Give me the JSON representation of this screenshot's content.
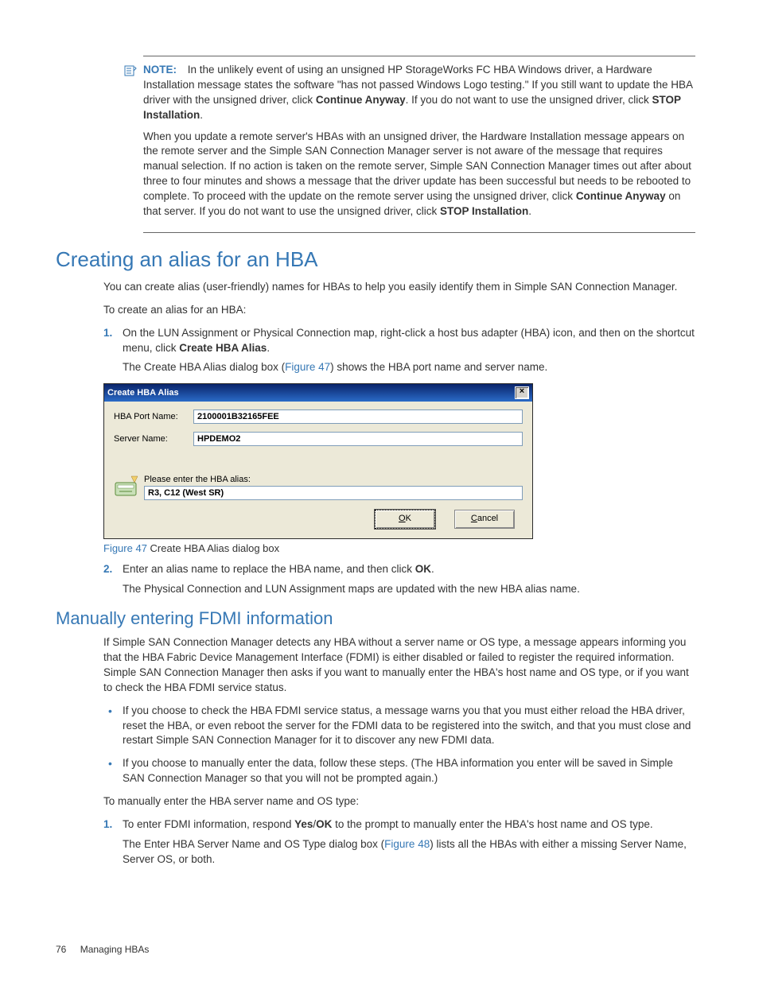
{
  "note": {
    "label": "NOTE:",
    "para1_a": "In the unlikely event of using an unsigned HP StorageWorks FC HBA Windows driver, a Hardware Installation message states the software \"has not passed Windows Logo testing.\" If you still want to update the HBA driver with the unsigned driver, click ",
    "para1_b1": "Continue Anyway",
    "para1_c": ". If you do not want to use the unsigned driver, click ",
    "para1_b2": "STOP Installation",
    "para1_d": ".",
    "para2_a": "When you update a remote server's HBAs with an unsigned driver, the Hardware Installation message appears on the remote server and the Simple SAN Connection Manager server is not aware of the message that requires manual selection. If no action is taken on the remote server, Simple SAN Connection Manager times out after about three to four minutes and shows a message that the driver update has been successful but needs to be rebooted to complete. To proceed with the update on the remote server using the unsigned driver, click ",
    "para2_b1": "Continue Anyway",
    "para2_c": " on that server. If you do not want to use the unsigned driver, click ",
    "para2_b2": "STOP Installation",
    "para2_d": "."
  },
  "section1": {
    "title": "Creating an alias for an HBA",
    "intro": "You can create alias (user-friendly) names for HBAs to help you easily identify them in Simple SAN Connection Manager.",
    "lead": "To create an alias for an HBA:",
    "step1_a": "On the LUN Assignment or Physical Connection map, right-click a host bus adapter (HBA) icon, and then on the shortcut menu, click ",
    "step1_b": "Create HBA Alias",
    "step1_c": ".",
    "step1_after_a": "The Create HBA Alias dialog box (",
    "step1_after_link": "Figure 47",
    "step1_after_b": ") shows the HBA port name and server name.",
    "fig_num": "Figure 47",
    "fig_caption": " Create HBA Alias dialog box",
    "step2_a": "Enter an alias name to replace the HBA name, and then click ",
    "step2_b": "OK",
    "step2_c": ".",
    "step2_after": "The Physical Connection and LUN Assignment maps are updated with the new HBA alias name."
  },
  "dialog": {
    "title": "Create HBA Alias",
    "close": "×",
    "label_port": "HBA Port Name:",
    "val_port": "2100001B32165FEE",
    "label_server": "Server Name:",
    "val_server": "HPDEMO2",
    "prompt": "Please enter the HBA alias:",
    "val_alias": "R3, C12 (West SR)",
    "ok_pre": "O",
    "ok_post": "K",
    "cancel_pre": "C",
    "cancel_post": "ancel"
  },
  "section2": {
    "title": "Manually entering FDMI information",
    "intro": "If Simple SAN Connection Manager detects any HBA without a server name or OS type, a message appears informing you that the HBA Fabric Device Management Interface (FDMI) is either disabled or failed to register the required information. Simple SAN Connection Manager then asks if you want to manually enter the HBA's host name and OS type, or if you want to check the HBA FDMI service status.",
    "bullet1": "If you choose to check the HBA FDMI service status, a message warns you that you must either reload the HBA driver, reset the HBA, or even reboot the server for the FDMI data to be registered into the switch, and that you must close and restart Simple SAN Connection Manager for it to discover any new FDMI data.",
    "bullet2": "If you choose to manually enter the data, follow these steps. (The HBA information you enter will be saved in Simple SAN Connection Manager so that you will not be prompted again.)",
    "lead": "To manually enter the HBA server name and OS type:",
    "step1_a": "To enter FDMI information, respond ",
    "step1_b1": "Yes",
    "step1_slash": "/",
    "step1_b2": "OK",
    "step1_c": " to the prompt to manually enter the HBA's host name and OS type.",
    "step1_after_a": "The Enter HBA Server Name and OS Type dialog box (",
    "step1_after_link": "Figure 48",
    "step1_after_b": ") lists all the HBAs with either a missing Server Name, Server OS, or both."
  },
  "footer": {
    "page": "76",
    "chapter": "Managing HBAs"
  }
}
